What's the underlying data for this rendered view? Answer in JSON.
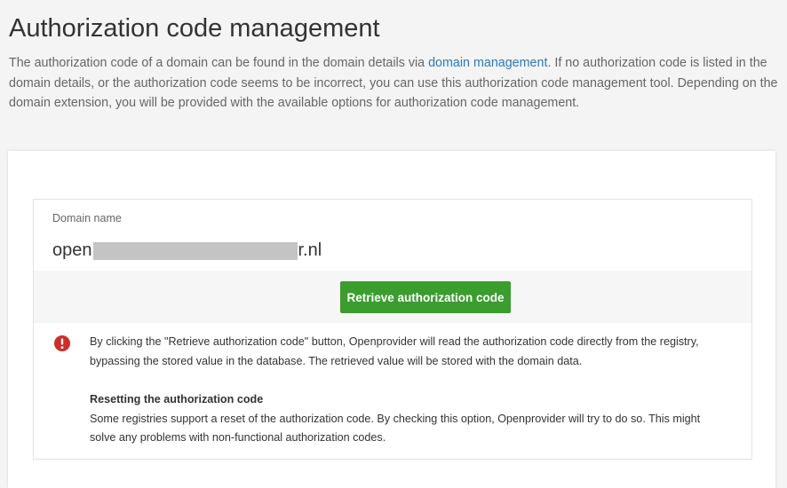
{
  "header": {
    "title": "Authorization code management"
  },
  "intro": {
    "text_before_link": "The authorization code of a domain can be found in the domain details via ",
    "link_text": "domain management",
    "text_after_link": ". If no authorization code is listed in the domain details, or the authorization code seems to be incorrect, you can use this authorization code management tool. Depending on the domain extension, you will be provided with the available options for authorization code management."
  },
  "domain": {
    "label": "Domain name",
    "value_prefix": "open",
    "value_suffix": "r.nl"
  },
  "actions": {
    "retrieve_label": "Retrieve authorization code"
  },
  "notice": {
    "icon": "exclamation-circle-icon",
    "text": "By clicking the \"Retrieve authorization code\" button, Openprovider will read the authorization code directly from the registry, bypassing the stored value in the database. The retrieved value will be stored with the domain data.",
    "reset_heading": "Resetting the authorization code",
    "reset_text": "Some registries support a reset of the authorization code. By checking this option, Openprovider will try to do so. This might solve any problems with non-functional authorization codes."
  },
  "colors": {
    "primary_button": "#3a9d2e",
    "link": "#2a7ab8",
    "alert_icon": "#c9302c"
  }
}
